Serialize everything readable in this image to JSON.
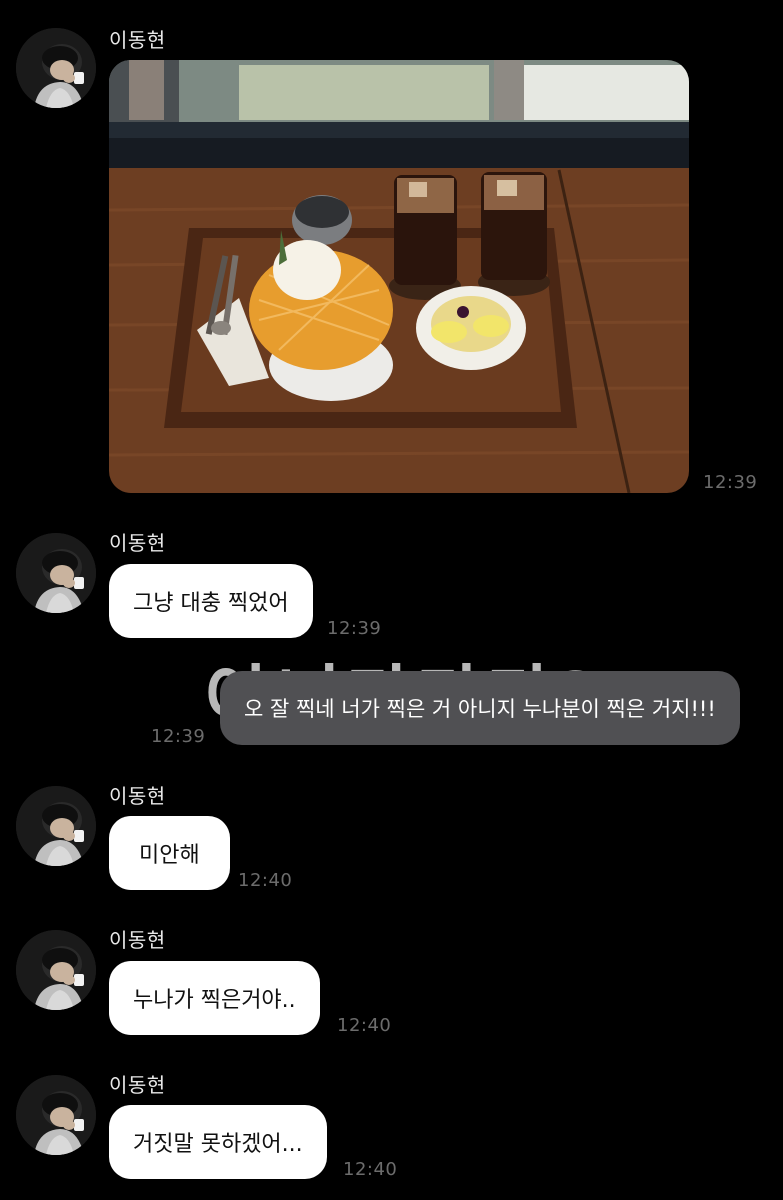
{
  "chat": {
    "sender_name": "이동현",
    "messages": [
      {
        "type": "image",
        "time": "12:39"
      },
      {
        "type": "text",
        "text": "그냥 대충 찍었어",
        "time": "12:39"
      },
      {
        "type": "text_me",
        "text": "오 잘 찍네 너가 찍은 거 아니지 누나분이 찍은 거지!!!",
        "time": "12:39"
      },
      {
        "type": "text",
        "text": "미안해",
        "time": "12:40"
      },
      {
        "type": "text",
        "text": "누나가 찍은거야..",
        "time": "12:40"
      },
      {
        "type": "text",
        "text": "거짓말 못하겠어...",
        "time": "12:40"
      }
    ]
  },
  "colors": {
    "background": "#000000",
    "bubble_them": "#ffffff",
    "bubble_me": "#505053",
    "timestamp": "#6c6c6c"
  }
}
